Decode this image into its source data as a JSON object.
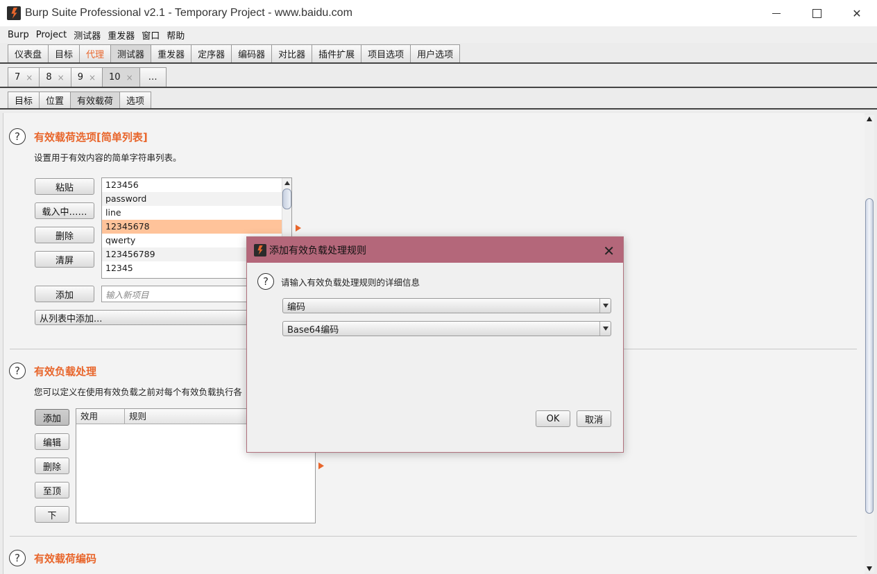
{
  "window": {
    "title": "Burp Suite Professional v2.1 - Temporary Project - www.baidu.com",
    "controls": {
      "minimize": "",
      "maximize": "",
      "close": "✕"
    }
  },
  "menu": [
    "Burp",
    "Project",
    "测试器",
    "重发器",
    "窗口",
    "帮助"
  ],
  "main_tabs": [
    "仪表盘",
    "目标",
    "代理",
    "测试器",
    "重发器",
    "定序器",
    "编码器",
    "对比器",
    "插件扩展",
    "项目选项",
    "用户选项"
  ],
  "attack_tabs": [
    {
      "label": "7",
      "close": "×"
    },
    {
      "label": "8",
      "close": "×"
    },
    {
      "label": "9",
      "close": "×"
    },
    {
      "label": "10",
      "close": "×"
    },
    {
      "label": "…",
      "close": ""
    }
  ],
  "sub_tabs": [
    "目标",
    "位置",
    "有效载荷",
    "选项"
  ],
  "payload_options": {
    "help": "?",
    "title": "有效载荷选项[简单列表]",
    "description": "设置用于有效内容的简单字符串列表。",
    "buttons": {
      "paste": "粘贴",
      "load": "载入中……",
      "remove": "删除",
      "clear": "清屏",
      "add": "添加"
    },
    "list_items": [
      "123456",
      "password",
      "line",
      "12345678",
      "qwerty",
      "123456789",
      "12345"
    ],
    "selected_index": 3,
    "new_item_placeholder": "输入新项目",
    "add_from_list": "从列表中添加..."
  },
  "payload_processing": {
    "help": "?",
    "title": "有效负载处理",
    "description": "您可以定义在使用有效负载之前对每个有效负载执行各",
    "buttons": {
      "add": "添加",
      "edit": "编辑",
      "remove": "删除",
      "up": "至顶",
      "down": "下"
    },
    "columns": [
      "效用",
      "规则"
    ]
  },
  "payload_encoding": {
    "help": "?",
    "title": "有效载荷编码"
  },
  "dialog": {
    "title": "添加有效负载处理规则",
    "close": "✕",
    "help": "?",
    "prompt": "请输入有效负载处理规则的详细信息",
    "rule_type": "编码",
    "rule_value": "Base64编码",
    "ok": "OK",
    "cancel": "取消"
  },
  "colors": {
    "accent": "#e8662c",
    "dialog_titlebar": "#b4677a",
    "selected_row": "#ffc39a"
  }
}
